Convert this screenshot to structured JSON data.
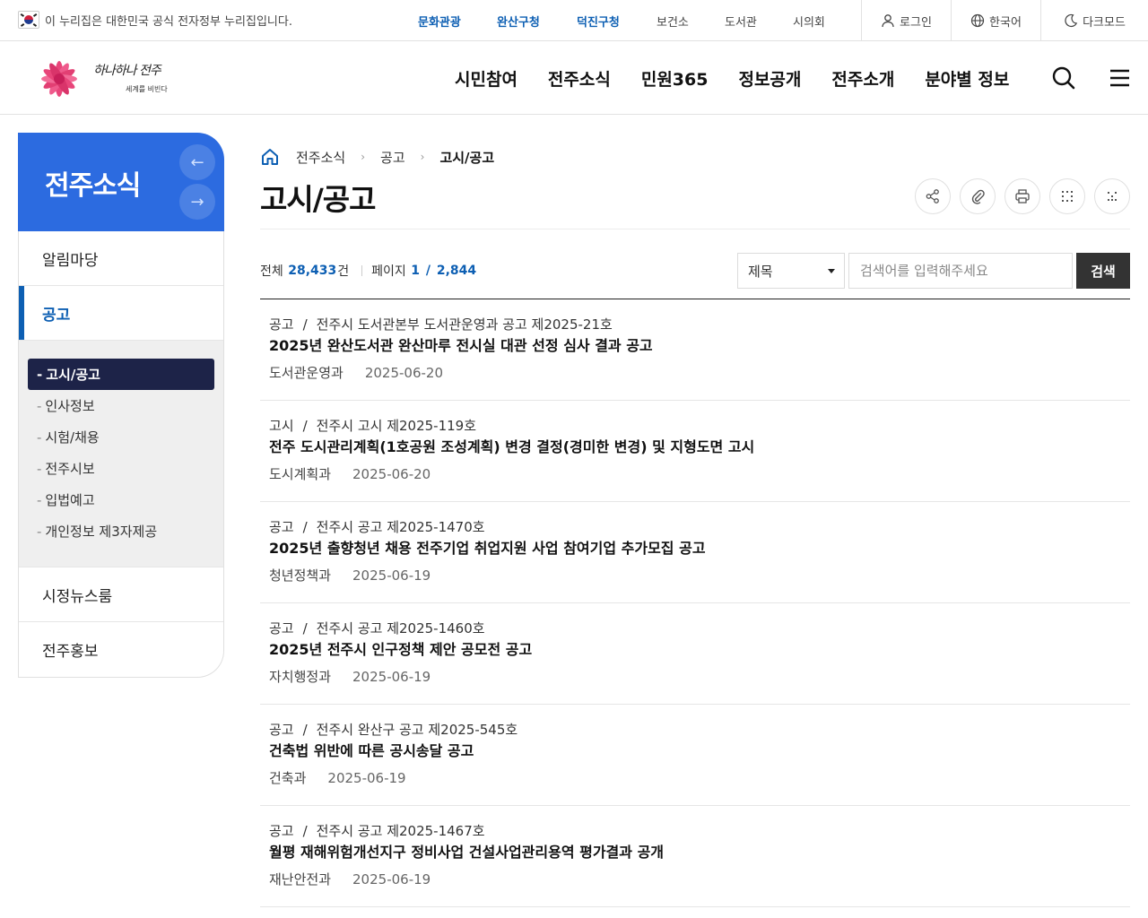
{
  "topbar": {
    "gov_notice": "이 누리집은 대한민국 공식 전자정부 누리집입니다.",
    "links": [
      {
        "label": "문화관광",
        "highlight": true
      },
      {
        "label": "완산구청",
        "highlight": true
      },
      {
        "label": "덕진구청",
        "highlight": true
      },
      {
        "label": "보건소",
        "highlight": false
      },
      {
        "label": "도서관",
        "highlight": false
      },
      {
        "label": "시의회",
        "highlight": false
      }
    ],
    "login": "로그인",
    "language": "한국어",
    "darkmode": "다크모드"
  },
  "header": {
    "logo_text": "하나하나 전주",
    "logo_sub": "세계를 비빈다",
    "menu": [
      "시민참여",
      "전주소식",
      "민원365",
      "정보공개",
      "전주소개",
      "분야별 정보"
    ]
  },
  "sidebar": {
    "title": "전주소식",
    "items": [
      {
        "label": "알림마당"
      },
      {
        "label": "공고"
      },
      {
        "label": "시정뉴스룸"
      },
      {
        "label": "전주홍보"
      }
    ],
    "subitems": [
      "고시/공고",
      "인사정보",
      "시험/채용",
      "전주시보",
      "입법예고",
      "개인정보 제3자제공"
    ]
  },
  "breadcrumb": [
    "전주소식",
    "공고",
    "고시/공고"
  ],
  "page": {
    "title": "고시/공고"
  },
  "summary": {
    "total_label": "전체",
    "total_count": "28,433",
    "total_unit": "건",
    "page_label": "페이지",
    "page_current": "1",
    "page_total": "2,844"
  },
  "search": {
    "select_value": "제목",
    "placeholder": "검색어를 입력해주세요",
    "button": "검색"
  },
  "posts": [
    {
      "category": "공고",
      "number": "전주시 도서관본부 도서관운영과 공고 제2025-21호",
      "title": "2025년 완산도서관 완산마루 전시실 대관 선정 심사 결과 공고",
      "dept": "도서관운영과",
      "date": "2025-06-20"
    },
    {
      "category": "고시",
      "number": "전주시 고시 제2025-119호",
      "title": "전주 도시관리계획(1호공원 조성계획) 변경 결정(경미한 변경) 및 지형도면 고시",
      "dept": "도시계획과",
      "date": "2025-06-20"
    },
    {
      "category": "공고",
      "number": "전주시 공고 제2025-1470호",
      "title": "2025년 출향청년 채용 전주기업 취업지원 사업 참여기업 추가모집 공고",
      "dept": "청년정책과",
      "date": "2025-06-19"
    },
    {
      "category": "공고",
      "number": "전주시 공고 제2025-1460호",
      "title": "2025년 전주시 인구정책 제안 공모전 공고",
      "dept": "자치행정과",
      "date": "2025-06-19"
    },
    {
      "category": "공고",
      "number": "전주시 완산구 공고 제2025-545호",
      "title": "건축법 위반에 따른 공시송달 공고",
      "dept": "건축과",
      "date": "2025-06-19"
    },
    {
      "category": "공고",
      "number": "전주시 공고 제2025-1467호",
      "title": "월평 재해위험개선지구 정비사업 건설사업관리용역 평가결과 공개",
      "dept": "재난안전과",
      "date": "2025-06-19"
    }
  ],
  "colors": {
    "primary_blue": "#0d5fb3",
    "sidebar_header": "#2c6be0",
    "active_submenu": "#1d2348"
  }
}
